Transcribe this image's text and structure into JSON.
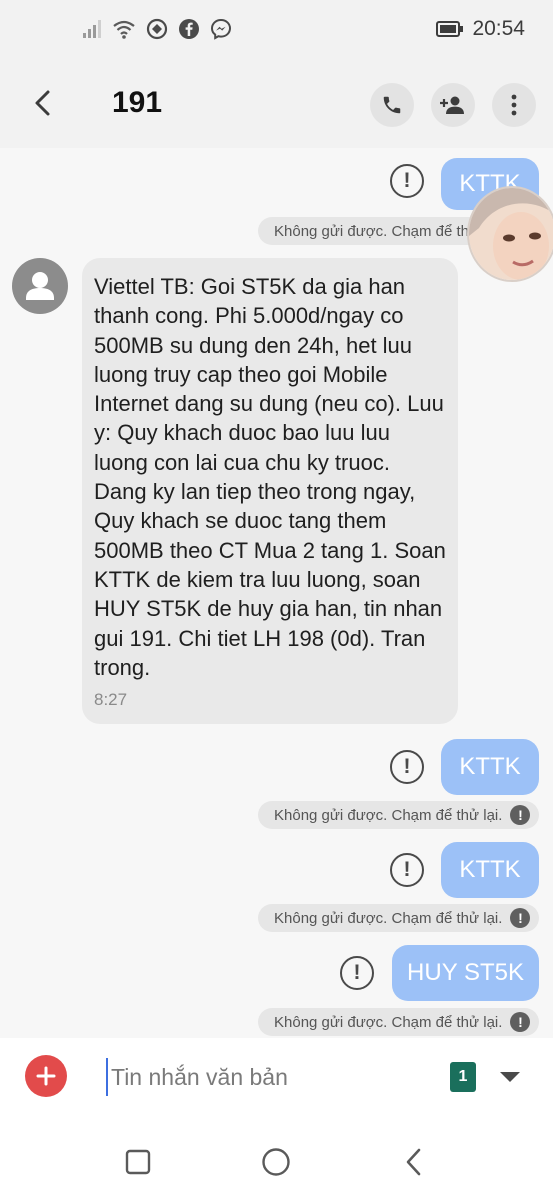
{
  "status_bar": {
    "time": "20:54",
    "icons": [
      "signal-icon",
      "wifi-icon",
      "sync-icon",
      "facebook-icon",
      "messenger-icon",
      "battery-icon"
    ]
  },
  "header": {
    "title": "191",
    "actions": [
      "phone-icon",
      "add-contact-icon",
      "more-options-icon"
    ]
  },
  "messages": {
    "m1": {
      "text": "KTTK",
      "status": "Không gửi được. Chạm để thử lại."
    },
    "incoming": {
      "text": "Viettel TB: Goi ST5K da gia han thanh cong. Phi 5.000d/ngay co 500MB su dung den 24h, het luu luong truy cap theo goi Mobile Internet dang su dung (neu co). Luu y: Quy khach duoc bao luu luu luong con lai cua chu ky truoc. Dang ky lan tiep theo trong ngay, Quy khach se duoc tang them 500MB theo CT Mua 2 tang 1. Soan KTTK de kiem tra luu luong, soan HUY ST5K de huy gia han, tin nhan gui 191. Chi tiet LH 198 (0d). Tran trong.",
      "time": "8:27"
    },
    "m2": {
      "text": "KTTK",
      "status": "Không gửi được. Chạm để thử lại."
    },
    "m3": {
      "text": "KTTK",
      "status": "Không gửi được. Chạm để thử lại."
    },
    "m4": {
      "text": "HUY ST5K",
      "status": "Không gửi được. Chạm để thử lại."
    },
    "failed_glyph": "!"
  },
  "compose": {
    "placeholder": "Tin nhắn văn bản",
    "sim_number": "1"
  },
  "colors": {
    "outgoing_bubble": "#9cc1f7",
    "incoming_bubble": "#e9e9e9",
    "add_button": "#e24b4b",
    "sim_badge": "#1a6f5c"
  }
}
